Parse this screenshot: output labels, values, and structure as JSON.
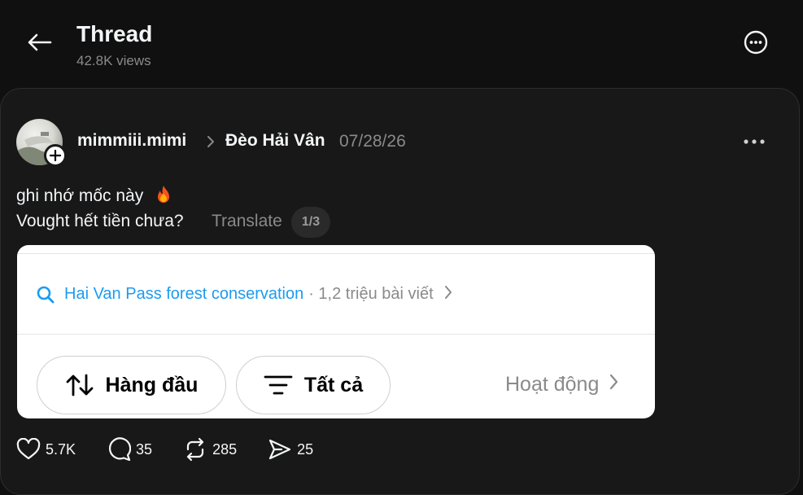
{
  "header": {
    "title": "Thread",
    "views": "42.8K views"
  },
  "post": {
    "username": "mimmiii.mimi",
    "location": "Đèo Hải Vân",
    "date": "07/28/26",
    "line1": "ghi nhớ mốc này",
    "line2": "Vought hết tiền chưa?",
    "translate_label": "Translate",
    "page_indicator": "1/3",
    "embed": {
      "search_query": "Hai Van Pass forest conservation",
      "search_meta": "· 1,2 triệu bài viết",
      "top_label": "Hàng đầu",
      "all_label": "Tất cả",
      "activity_label": "Hoạt động"
    },
    "stats": {
      "likes": "5.7K",
      "replies": "35",
      "reposts": "285",
      "shares": "25"
    }
  },
  "colors": {
    "background": "#101010",
    "card": "#181818",
    "link_blue": "#1d9bf0",
    "muted": "#8a8a8a"
  }
}
